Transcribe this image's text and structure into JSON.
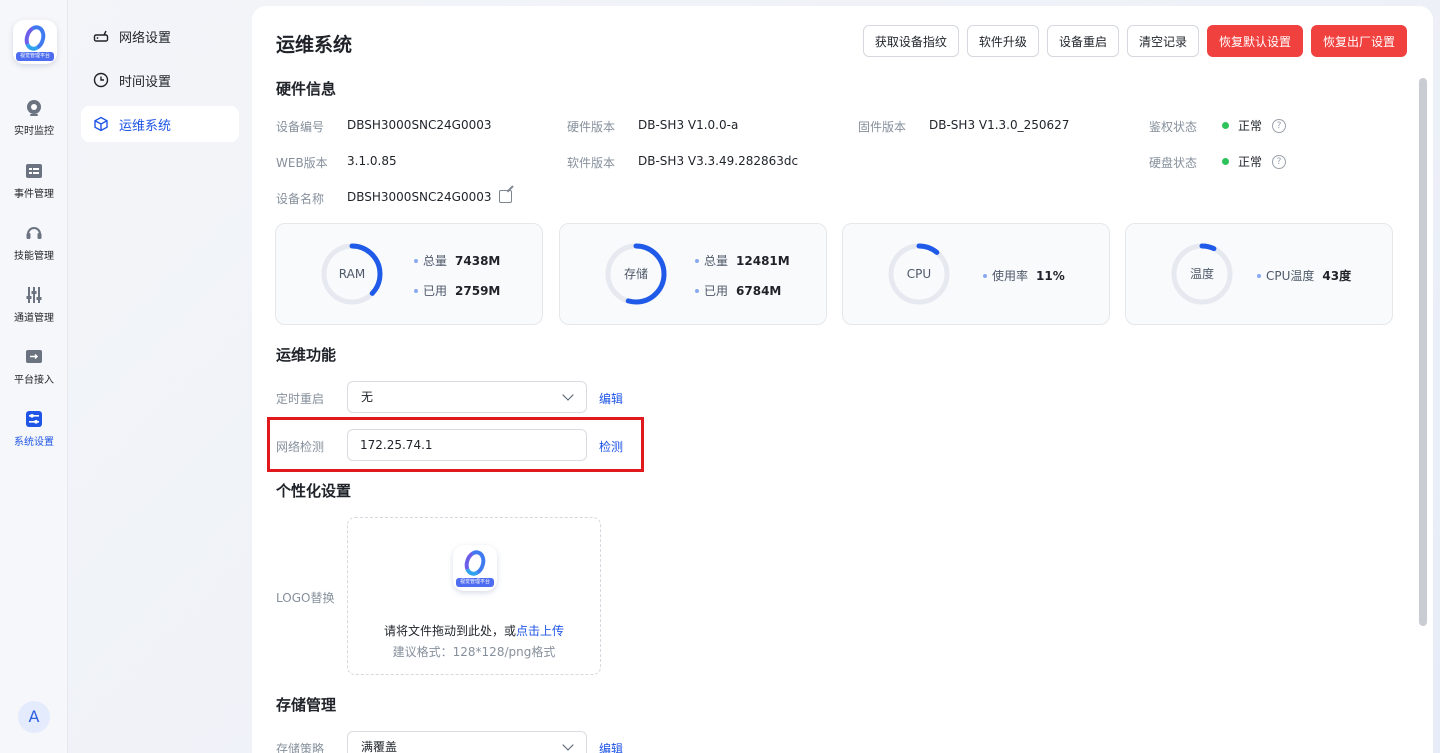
{
  "rail": {
    "logo_caption": "视觉管理平台",
    "items": [
      {
        "label": "实时监控",
        "icon": "camera-icon"
      },
      {
        "label": "事件管理",
        "icon": "event-list-icon"
      },
      {
        "label": "技能管理",
        "icon": "headset-icon"
      },
      {
        "label": "通道管理",
        "icon": "sliders-icon"
      },
      {
        "label": "平台接入",
        "icon": "platform-access-icon"
      },
      {
        "label": "系统设置",
        "icon": "system-settings-icon",
        "active": true
      }
    ],
    "avatar": "A"
  },
  "submenu": {
    "items": [
      {
        "label": "网络设置",
        "icon": "router-icon"
      },
      {
        "label": "时间设置",
        "icon": "clock-icon"
      },
      {
        "label": "运维系统",
        "icon": "cube-icon",
        "active": true
      }
    ]
  },
  "page": {
    "title": "运维系统",
    "actions": [
      "获取设备指纹",
      "软件升级",
      "设备重启",
      "清空记录",
      "恢复默认设置",
      "恢复出厂设置"
    ]
  },
  "hardware": {
    "title": "硬件信息",
    "device_no_label": "设备编号",
    "device_no": "DBSH3000SNC24G0003",
    "hw_version_label": "硬件版本",
    "hw_version": "DB-SH3 V1.0.0-a",
    "fw_version_label": "固件版本",
    "fw_version": "DB-SH3 V1.3.0_250627",
    "auth_status_label": "鉴权状态",
    "auth_status": "正常",
    "web_version_label": "WEB版本",
    "web_version": "3.1.0.85",
    "sw_version_label": "软件版本",
    "sw_version": "DB-SH3 V3.3.49.282863dc",
    "disk_status_label": "硬盘状态",
    "disk_status": "正常",
    "device_name_label": "设备名称",
    "device_name": "DBSH3000SNC24G0003",
    "status_color": "#2ec25a"
  },
  "stats": {
    "ram": {
      "label": "RAM",
      "total_label": "总量",
      "total": "7438M",
      "used_label": "已用",
      "used": "2759M",
      "fraction": 0.371
    },
    "storage": {
      "label": "存储",
      "total_label": "总量",
      "total": "12481M",
      "used_label": "已用",
      "used": "6784M",
      "fraction": 0.544
    },
    "cpu": {
      "label": "CPU",
      "usage_label": "使用率",
      "usage": "11%",
      "fraction": 0.11
    },
    "temperature": {
      "label": "温度",
      "cpu_temp_label": "CPU温度",
      "cpu_temp": "43度",
      "fraction": 0.07
    },
    "gauge_color": "#1f5ae8",
    "track_color": "#e6e9f0"
  },
  "ops": {
    "title": "运维功能",
    "reboot_label": "定时重启",
    "reboot_value": "无",
    "reboot_action": "编辑",
    "netcheck_label": "网络检测",
    "netcheck_value": "172.25.74.1",
    "netcheck_action": "检测"
  },
  "personal": {
    "title": "个性化设置",
    "logo_label": "LOGO替换",
    "logo_caption": "视觉管理平台",
    "upload_text": "请将文件拖动到此处，或",
    "upload_link": "点击上传",
    "upload_hint": "建议格式：128*128/png格式"
  },
  "storage_mgmt": {
    "title": "存储管理",
    "policy_label": "存储策略",
    "policy_value": "满覆盖",
    "policy_action": "编辑"
  },
  "colors": {
    "accent": "#1f55e6",
    "danger": "#f0413f",
    "highlight": "#e0191c"
  }
}
